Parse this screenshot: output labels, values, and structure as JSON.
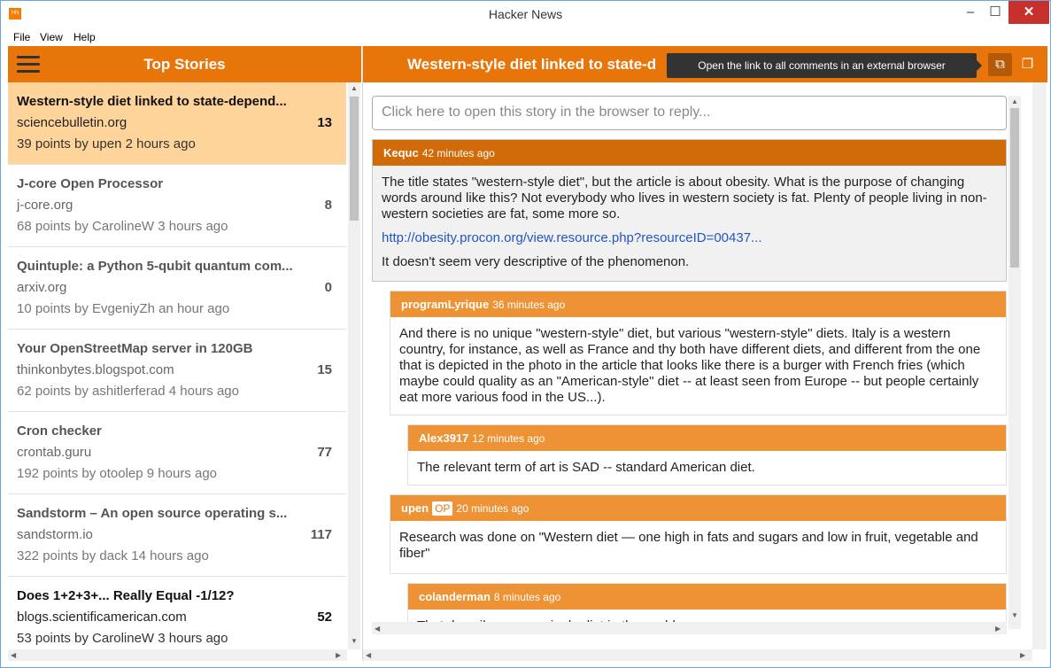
{
  "window": {
    "title": "Hacker News",
    "icon_text": "HN"
  },
  "menu": {
    "file": "File",
    "view": "View",
    "help": "Help"
  },
  "left": {
    "title": "Top Stories"
  },
  "stories": [
    {
      "title": "Western-style diet linked to state-depend...",
      "domain": "sciencebulletin.org",
      "meta": "39 points by upen 2 hours ago",
      "count": "13"
    },
    {
      "title": "J-core Open Processor",
      "domain": "j-core.org",
      "meta": "68 points by CarolineW 3 hours ago",
      "count": "8"
    },
    {
      "title": "Quintuple: a Python 5-qubit quantum com...",
      "domain": "arxiv.org",
      "meta": "10 points by EvgeniyZh an hour ago",
      "count": "0"
    },
    {
      "title": "Your OpenStreetMap server in 120GB",
      "domain": "thinkonbytes.blogspot.com",
      "meta": "62 points by ashitlerferad 4 hours ago",
      "count": "15"
    },
    {
      "title": "Cron checker",
      "domain": "crontab.guru",
      "meta": "192 points by otoolep 9 hours ago",
      "count": "77"
    },
    {
      "title": "Sandstorm – An open source operating s...",
      "domain": "sandstorm.io",
      "meta": "322 points by dack 14 hours ago",
      "count": "117"
    },
    {
      "title": "Does 1+2+3+... Really Equal -1/12?",
      "domain": "blogs.scientificamerican.com",
      "meta": "53 points by CarolineW 3 hours ago",
      "count": "52"
    }
  ],
  "right": {
    "title": "Western-style diet linked to state-d",
    "tooltip": "Open the link to all comments in an external browser",
    "reply_placeholder": "Click here to open this story in the browser to reply..."
  },
  "comments": [
    {
      "user": "Kequc",
      "age": "42 minutes ago",
      "paras": [
        "The title states \"western-style diet\", but the article is about obesity. What is the purpose of changing words around like this? Not everybody who lives in western society is fat. Plenty of people living in non-western societies are fat, some more so."
      ],
      "link": "http://obesity.procon.org/view.resource.php?resourceID=00437...",
      "tail": "It doesn't seem very descriptive of the phenomenon."
    },
    {
      "user": "programLyrique",
      "age": "36 minutes ago",
      "text": "And there is no unique \"western-style\" diet, but various \"western-style\" diets. Italy is a western country, for instance, as well as France and thy both have different diets, and different from the one that is depicted in the photo in the article that looks like there is a burger with French fries (which maybe could quality as an \"American-style\" diet -- at least seen from Europe -- but people certainly eat more various food in the US...)."
    },
    {
      "user": "Alex3917",
      "age": "12 minutes ago",
      "text": "The relevant term of art is SAD -- standard American diet."
    },
    {
      "user": "upen",
      "op": "OP",
      "age": "20 minutes ago",
      "text": "Research was done on \"Western diet — one high in fats and sugars and low in fruit, vegetable and fiber\""
    },
    {
      "user": "colanderman",
      "age": "8 minutes ago",
      "text": "That describes every single diet in the world..."
    }
  ]
}
